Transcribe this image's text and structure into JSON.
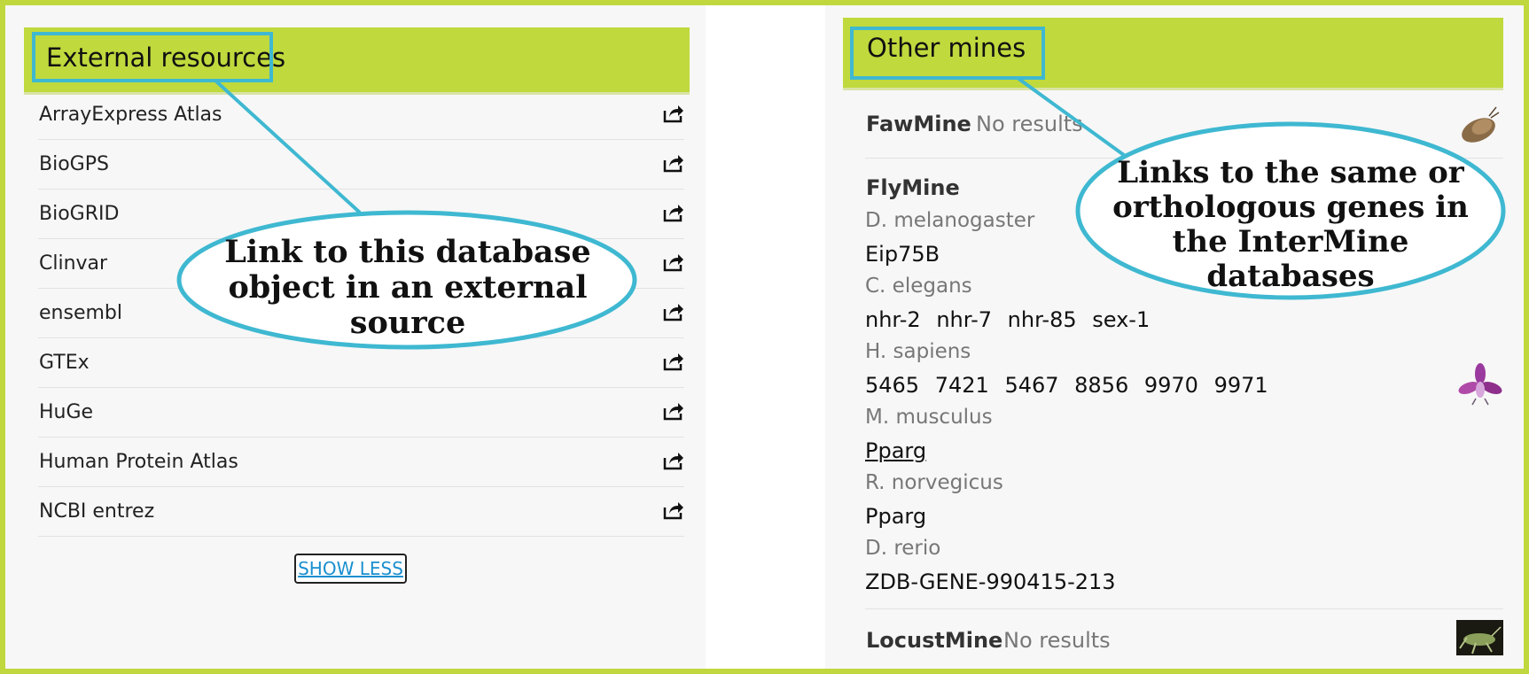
{
  "external_resources": {
    "title": "External resources",
    "items": [
      {
        "label": "ArrayExpress Atlas"
      },
      {
        "label": "BioGPS"
      },
      {
        "label": "BioGRID"
      },
      {
        "label": "Clinvar"
      },
      {
        "label": "ensembl"
      },
      {
        "label": "GTEx"
      },
      {
        "label": "HuGe"
      },
      {
        "label": "Human Protein Atlas"
      },
      {
        "label": "NCBI entrez"
      }
    ],
    "show_less_label": "SHOW LESS"
  },
  "other_mines": {
    "title": "Other mines",
    "mines": [
      {
        "name": "FawMine",
        "status": "No results"
      },
      {
        "name": "FlyMine",
        "orthologs": [
          {
            "organism": "D. melanogaster",
            "genes": [
              "Eip75B"
            ]
          },
          {
            "organism": "C. elegans",
            "genes": [
              "nhr-2",
              "nhr-7",
              "nhr-85",
              "sex-1"
            ]
          },
          {
            "organism": "H. sapiens",
            "genes": [
              "5465",
              "7421",
              "5467",
              "8856",
              "9970",
              "9971"
            ]
          },
          {
            "organism": "M. musculus",
            "genes": [
              "Pparg"
            ]
          },
          {
            "organism": "R. norvegicus",
            "genes": [
              "Pparg"
            ]
          },
          {
            "organism": "D. rerio",
            "genes": [
              "ZDB-GENE-990415-213"
            ]
          }
        ]
      },
      {
        "name": "LocustMine",
        "status": "No results"
      }
    ]
  },
  "annotations": {
    "external_callout": "Link to this database object in an external source",
    "external_callout_lines": [
      "Link to this database",
      "object in an external",
      "source"
    ],
    "mines_callout": "Links to the same or orthologous genes in the InterMine databases",
    "mines_callout_lines": [
      "Links to the same or",
      "orthologous genes in",
      "the InterMine",
      "databases"
    ]
  },
  "colors": {
    "header_green": "#c0d93d",
    "frame_green": "#c0d73d",
    "callout_cyan": "#3fb8d1",
    "link_blue": "#1a8fcf"
  },
  "icons": {
    "external_link": "share-external-icon",
    "fawmine": "moth-icon",
    "flymine": "fly-flower-icon",
    "locustmine": "locust-icon"
  }
}
